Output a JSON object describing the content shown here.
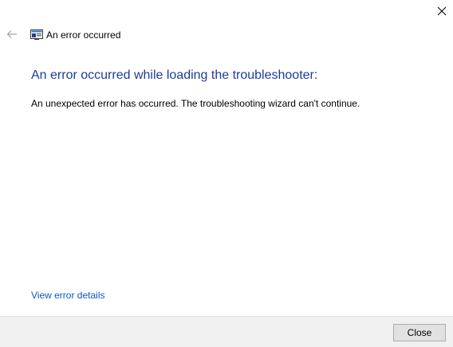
{
  "window": {
    "title": "An error occurred"
  },
  "icons": {
    "close": "close-icon",
    "back": "back-arrow-icon",
    "title": "troubleshooter-window-icon"
  },
  "main": {
    "heading": "An error occurred while loading the troubleshooter:",
    "message": "An unexpected error has occurred. The troubleshooting wizard can't continue.",
    "details_link": "View error details"
  },
  "footer": {
    "close_label": "Close"
  },
  "colors": {
    "heading": "#1e3b9a",
    "link": "#0a57c4",
    "footer_bg": "#f0f0f0"
  }
}
